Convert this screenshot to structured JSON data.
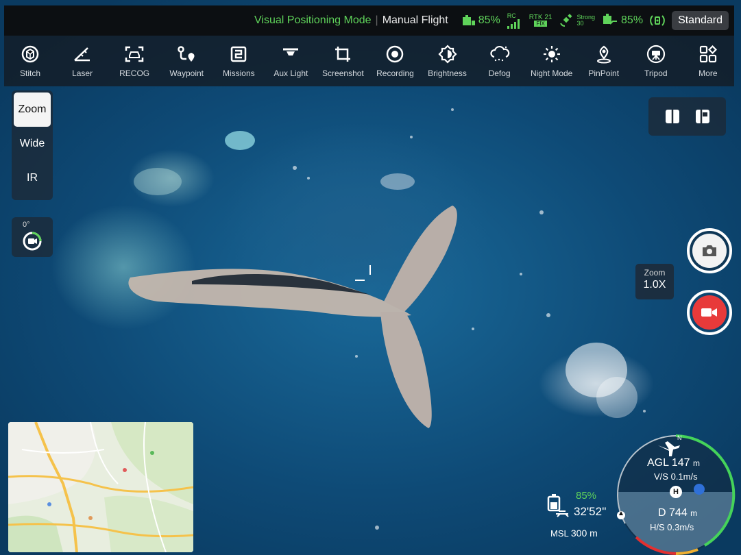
{
  "status_bar": {
    "positioning_mode": "Visual Positioning Mode",
    "separator": "|",
    "flight_mode": "Manual Flight",
    "rc_battery": "85%",
    "rc_signal_label": "RC",
    "rtk_label": "RTK 21",
    "rtk_status": "FIX",
    "gps_strength": "Strong",
    "gps_count": "30",
    "drone_battery": "85%",
    "profile_button": "Standard"
  },
  "toolbar": {
    "items": [
      {
        "label": "Stitch",
        "icon": "stitch-icon"
      },
      {
        "label": "Laser",
        "icon": "laser-icon"
      },
      {
        "label": "RECOG",
        "icon": "recog-icon"
      },
      {
        "label": "Waypoint",
        "icon": "waypoint-icon"
      },
      {
        "label": "Missions",
        "icon": "missions-icon"
      },
      {
        "label": "Aux Light",
        "icon": "aux-light-icon"
      },
      {
        "label": "Screenshot",
        "icon": "screenshot-icon"
      },
      {
        "label": "Recording",
        "icon": "recording-icon"
      },
      {
        "label": "Brightness",
        "icon": "brightness-icon"
      },
      {
        "label": "Defog",
        "icon": "defog-icon"
      },
      {
        "label": "Night Mode",
        "icon": "night-mode-icon"
      },
      {
        "label": "PinPoint",
        "icon": "pinpoint-icon"
      },
      {
        "label": "Tripod",
        "icon": "tripod-icon"
      },
      {
        "label": "More",
        "icon": "more-icon"
      }
    ]
  },
  "lens": {
    "options": [
      "Zoom",
      "Wide",
      "IR"
    ],
    "selected": "Zoom"
  },
  "gimbal": {
    "angle": "0°"
  },
  "zoom_indicator": {
    "title": "Zoom",
    "value": "1.0X"
  },
  "telemetry": {
    "battery_percent": "85%",
    "flight_time": "32'52''",
    "msl_label": "MSL",
    "msl_value": "300 m",
    "agl_label": "AGL",
    "agl_value": "147",
    "agl_unit": "m",
    "vs_label": "V/S",
    "vs_value": "0.1m/s",
    "distance_label": "D",
    "distance_value": "744",
    "distance_unit": "m",
    "hs_label": "H/S",
    "hs_value": "0.3m/s",
    "compass_north": "N",
    "home_marker": "H"
  },
  "colors": {
    "accent_green": "#5fd35a",
    "record_red": "#e83a3a",
    "toolbar_bg": "#141c26"
  }
}
